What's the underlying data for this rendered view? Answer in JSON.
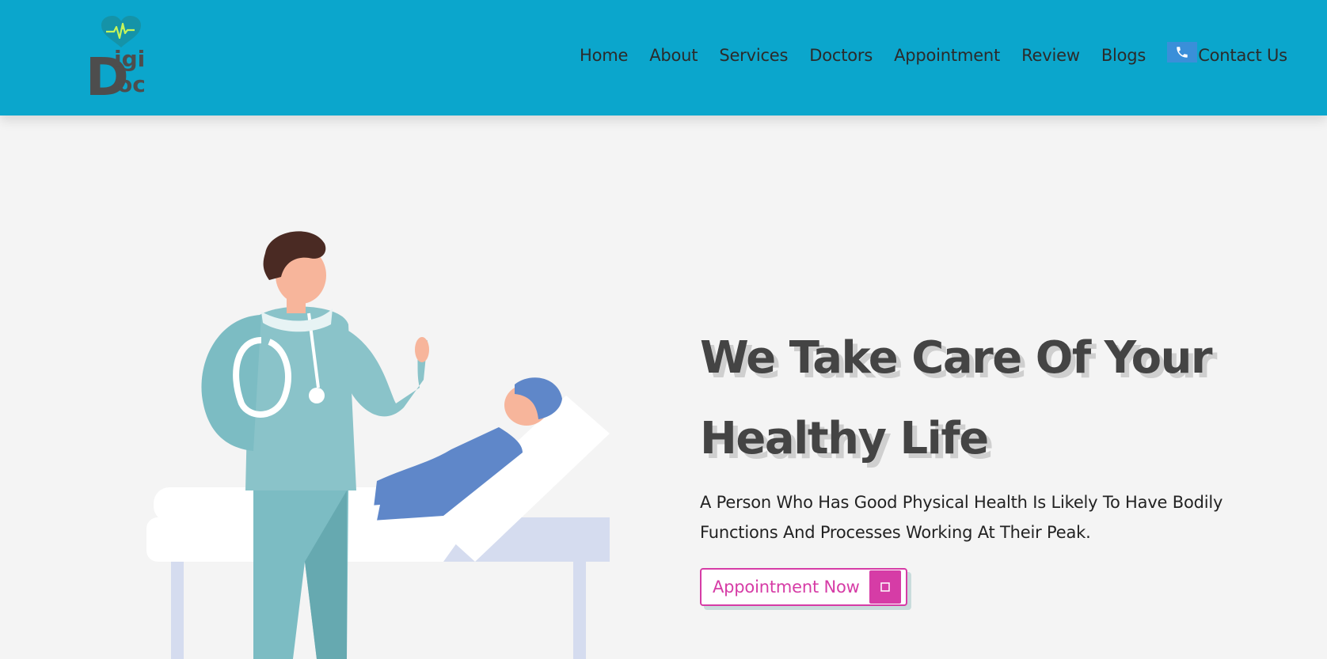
{
  "brand": {
    "logo_text_top": "igi",
    "logo_text_bottom": "oc",
    "logo_letter": "D",
    "heart_color": "#1593a8",
    "pulse_color": "#c6f55a",
    "letter_color": "#4d4d4d"
  },
  "nav": {
    "items": [
      {
        "label": "Home"
      },
      {
        "label": "About"
      },
      {
        "label": "Services"
      },
      {
        "label": "Doctors"
      },
      {
        "label": "Appointment"
      },
      {
        "label": "Review"
      },
      {
        "label": "Blogs"
      }
    ],
    "contact_label": "Contact Us",
    "contact_icon": "phone-icon",
    "background": "#0ba6cc"
  },
  "hero": {
    "title_line1": "We Take Care Of Your",
    "title_line2": "Healthy Life",
    "subtitle_line1": "A Person Who Has Good Physical Health Is Likely To Have Bodily",
    "subtitle_line2": "Functions And Processes Working At Their Peak.",
    "cta_label": "Appointment Now",
    "cta_icon": "arrow-icon",
    "accent": "#d63ca6"
  }
}
